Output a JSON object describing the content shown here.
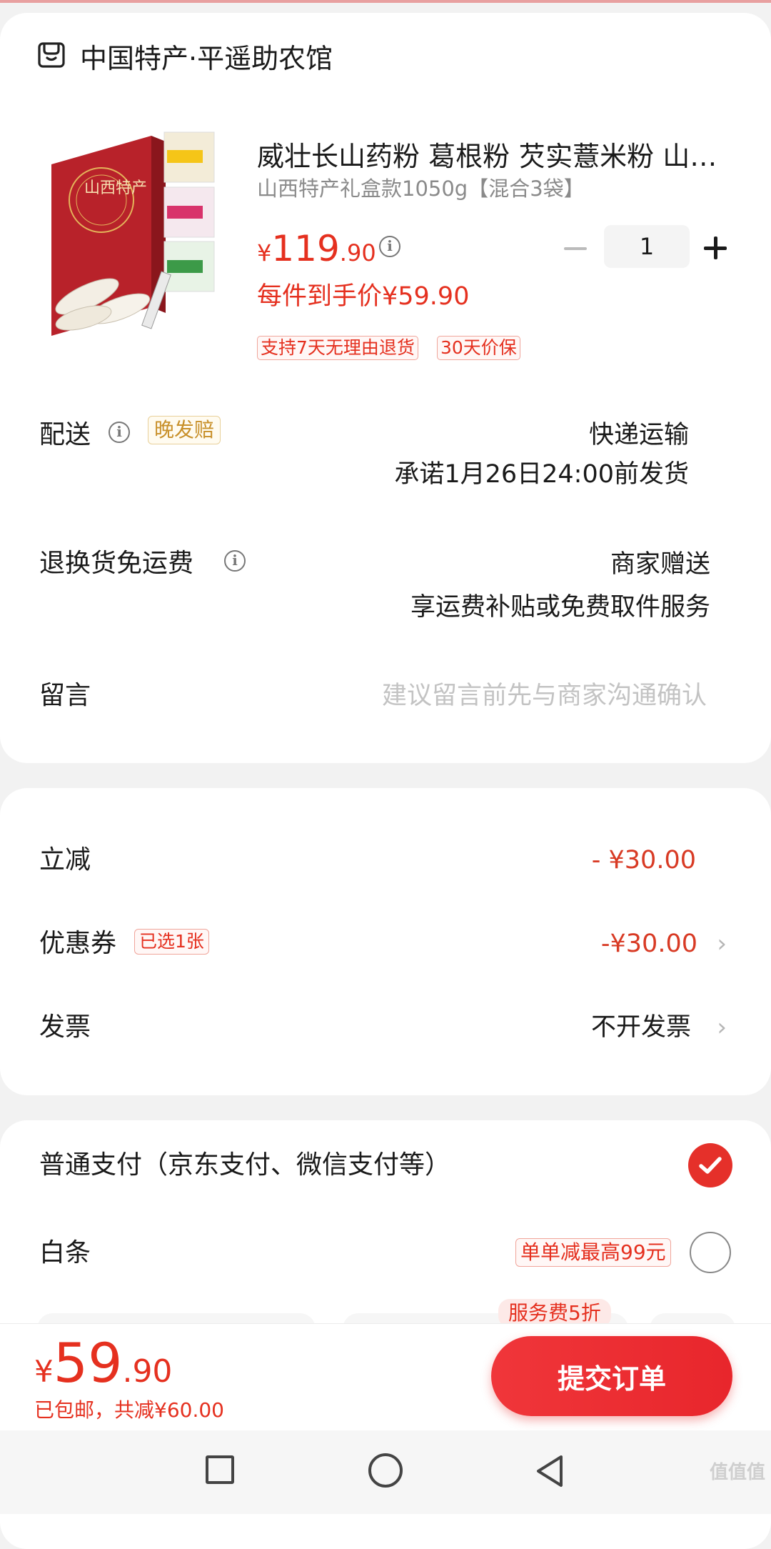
{
  "store": {
    "name": "中国特产·平遥助农馆",
    "icon": "store-icon"
  },
  "product": {
    "title": "威壮长山药粉 葛根粉 芡实薏米粉 山…",
    "subtitle": "山西特产礼盒款1050g【混合3袋】",
    "price_currency": "¥",
    "price_int": "119",
    "price_dec": ".90",
    "per_item_price": "每件到手价¥59.90",
    "quantity": "1",
    "tags": [
      "支持7天无理由退货",
      "30天价保"
    ],
    "image_text": "山西特产"
  },
  "delivery": {
    "label": "配送",
    "late_tag": "晚发赔",
    "method": "快递运输",
    "promise": "承诺1月26日24:00前发货"
  },
  "returns": {
    "label": "退换货免运费",
    "value": "商家赠送",
    "detail": "享运费补贴或免费取件服务"
  },
  "message": {
    "label": "留言",
    "placeholder": "建议留言前先与商家沟通确认"
  },
  "discount": {
    "label": "立减",
    "value": "- ¥30.00"
  },
  "coupon": {
    "label": "优惠券",
    "tag": "已选1张",
    "value": "-¥30.00"
  },
  "invoice": {
    "label": "发票",
    "value": "不开发票"
  },
  "payment": {
    "normal_label": "普通支付（京东支付、微信支付等）",
    "baitiao_label": "白条",
    "baitiao_tag": "单单减最高99元",
    "service_fee_tag": "服务费5折"
  },
  "bottom": {
    "total_currency": "¥",
    "total_int": "59",
    "total_dec": ".90",
    "note": "已包邮，共减¥60.00",
    "submit_label": "提交订单"
  },
  "watermark": "值值值",
  "colors": {
    "accent": "#e5301f",
    "late_tag": "#c8902a"
  }
}
